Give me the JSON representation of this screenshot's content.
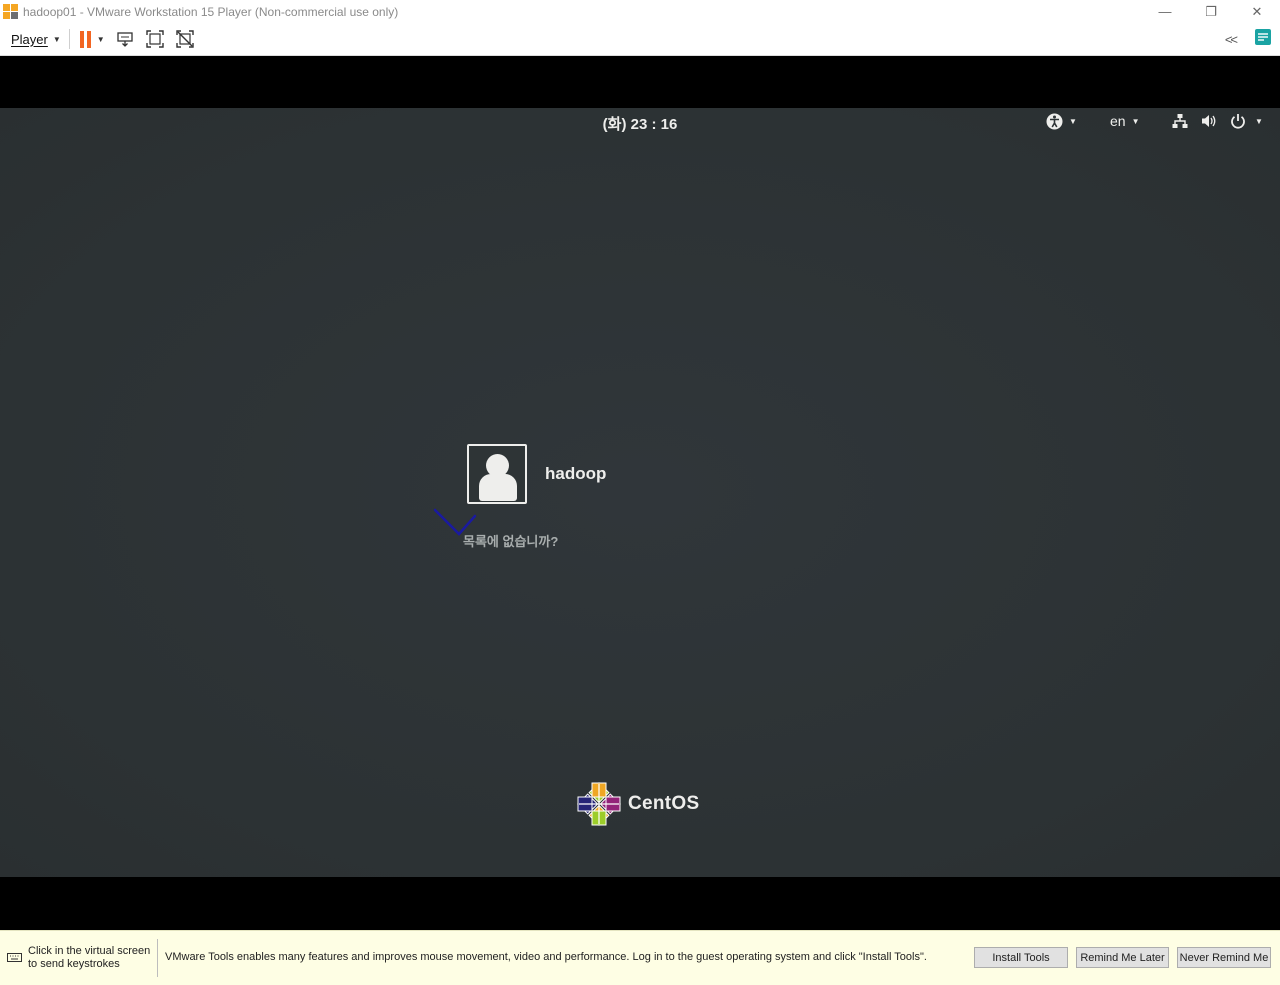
{
  "window": {
    "title": "hadoop01 - VMware Workstation 15 Player (Non-commercial use only)",
    "controls": {
      "minimize": "—",
      "restore": "❐",
      "close": "✕"
    }
  },
  "toolbar": {
    "player_menu_label": "Player",
    "icons": [
      "pause-icon",
      "send-ctrl-alt-del-icon",
      "fullscreen-icon",
      "unity-icon",
      "collapse-icon",
      "message-log-icon"
    ]
  },
  "gdm": {
    "clock": "(화) 23 : 16",
    "input_language": "en",
    "user": {
      "name": "hadoop"
    },
    "not_listed_label": "목록에 없습니까?",
    "brand_label": "CentOS"
  },
  "notification": {
    "click_hint_line1": "Click in the virtual screen",
    "click_hint_line2": "to send keystrokes",
    "message": "VMware Tools enables many features and improves mouse movement, video and performance. Log in to the guest operating system and click \"Install Tools\".",
    "install_label": "Install Tools",
    "remind_later_label": "Remind Me Later",
    "never_remind_label": "Never Remind Me"
  },
  "colors": {
    "gdm_background": "#2e3436",
    "gdm_text": "#eeeeec",
    "notify_background": "#fefee4",
    "pause_orange": "#f26522"
  }
}
